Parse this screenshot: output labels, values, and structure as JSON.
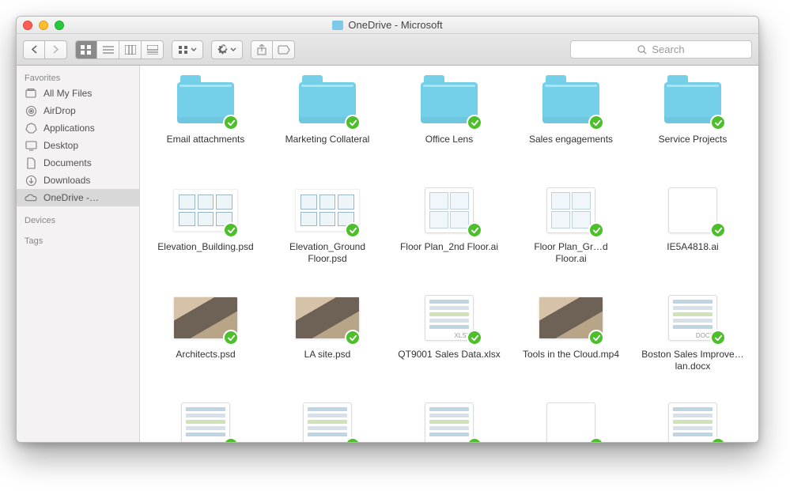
{
  "window": {
    "title": "OneDrive - Microsoft"
  },
  "search": {
    "placeholder": "Search"
  },
  "sidebar": {
    "sections": [
      {
        "title": "Favorites",
        "items": [
          {
            "label": "All My Files",
            "icon": "all-files"
          },
          {
            "label": "AirDrop",
            "icon": "airdrop"
          },
          {
            "label": "Applications",
            "icon": "applications"
          },
          {
            "label": "Desktop",
            "icon": "desktop"
          },
          {
            "label": "Documents",
            "icon": "documents"
          },
          {
            "label": "Downloads",
            "icon": "downloads"
          },
          {
            "label": "OneDrive -…",
            "icon": "onedrive",
            "selected": true
          }
        ]
      },
      {
        "title": "Devices",
        "items": []
      },
      {
        "title": "Tags",
        "items": []
      }
    ]
  },
  "items": [
    {
      "name": "Email attachments",
      "type": "folder"
    },
    {
      "name": "Marketing Collateral",
      "type": "folder"
    },
    {
      "name": "Office Lens",
      "type": "folder"
    },
    {
      "name": "Sales engagements",
      "type": "folder"
    },
    {
      "name": "Service Projects",
      "type": "folder"
    },
    {
      "name": "Elevation_Building.psd",
      "type": "thumb-plan"
    },
    {
      "name": "Elevation_Ground Floor.psd",
      "type": "thumb-plan"
    },
    {
      "name": "Floor Plan_2nd Floor.ai",
      "type": "page-plan"
    },
    {
      "name": "Floor Plan_Gr…d Floor.ai",
      "type": "page-plan"
    },
    {
      "name": "IE5A4818.ai",
      "type": "page-photo-person"
    },
    {
      "name": "Architects.psd",
      "type": "thumb-photo"
    },
    {
      "name": "LA site.psd",
      "type": "thumb-photo"
    },
    {
      "name": "QT9001 Sales Data.xlsx",
      "type": "page",
      "tag": "XLSX"
    },
    {
      "name": "Tools in the Cloud.mp4",
      "type": "thumb-photo"
    },
    {
      "name": "Boston Sales Improve…lan.docx",
      "type": "page",
      "tag": "DOCX"
    },
    {
      "name": "",
      "type": "page"
    },
    {
      "name": "",
      "type": "page"
    },
    {
      "name": "",
      "type": "page"
    },
    {
      "name": "",
      "type": "page-photo-person"
    },
    {
      "name": "",
      "type": "page"
    }
  ]
}
